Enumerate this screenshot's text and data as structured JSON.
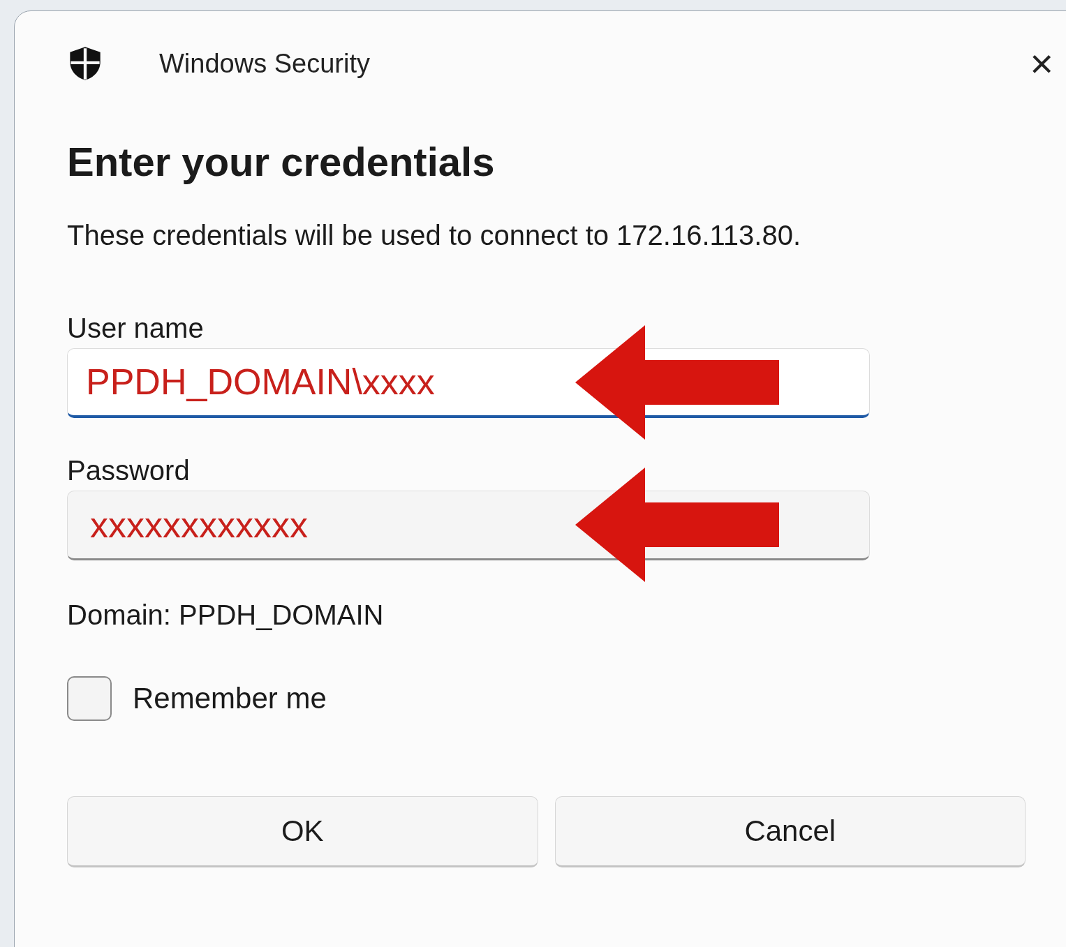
{
  "window": {
    "title": "Windows Security",
    "close": "×"
  },
  "heading": "Enter your credentials",
  "description": "These credentials will be used to connect to 172.16.113.80.",
  "fields": [
    {
      "label": "User name",
      "value": "PPDH_DOMAIN\\xxxx",
      "focused": true
    },
    {
      "label": "Password",
      "value": "xxxxxxxxxxxx",
      "focused": false
    }
  ],
  "domain": "Domain: PPDH_DOMAIN",
  "remember": {
    "label": "Remember me",
    "checked": false
  },
  "buttons": [
    "OK",
    "Cancel"
  ]
}
